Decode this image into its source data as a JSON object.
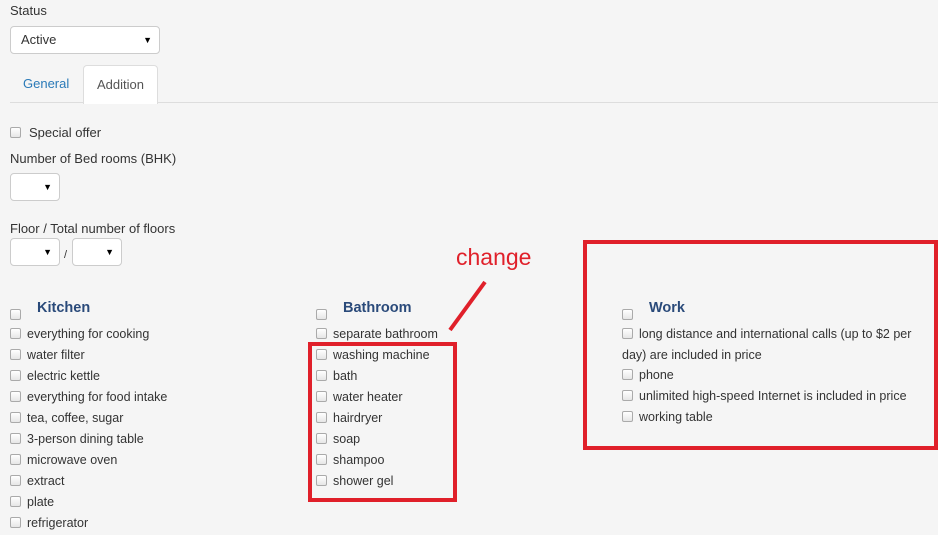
{
  "status": {
    "label": "Status",
    "value": "Active"
  },
  "tabs": [
    {
      "label": "General",
      "active": false
    },
    {
      "label": "Addition",
      "active": true
    }
  ],
  "special_offer": {
    "label": "Special offer",
    "checked": false
  },
  "bedrooms": {
    "label": "Number of Bed rooms (BHK)",
    "value": ""
  },
  "floors": {
    "label": "Floor / Total number of floors",
    "separator": "/",
    "floor": "",
    "total": ""
  },
  "kitchen": {
    "title": "Kitchen",
    "items": [
      "everything for cooking",
      "water filter",
      "electric kettle",
      "everything for food intake",
      "tea, coffee, sugar",
      "3-person dining table",
      "microwave oven",
      "extract",
      "plate",
      "refrigerator"
    ]
  },
  "bathroom": {
    "title": "Bathroom",
    "items": [
      "separate bathroom",
      "washing machine",
      "bath",
      "water heater",
      "hairdryer",
      "soap",
      "shampoo",
      "shower gel"
    ]
  },
  "work": {
    "title": "Work",
    "items": [
      "long distance and international calls (up to $2 per day) are included in price",
      "phone",
      "unlimited high-speed Internet is included in price",
      "working table"
    ]
  },
  "annotation": {
    "text": "change",
    "color": "#e0202a"
  },
  "colors": {
    "link": "#2a7ab8",
    "heading": "#2a4a7a"
  }
}
